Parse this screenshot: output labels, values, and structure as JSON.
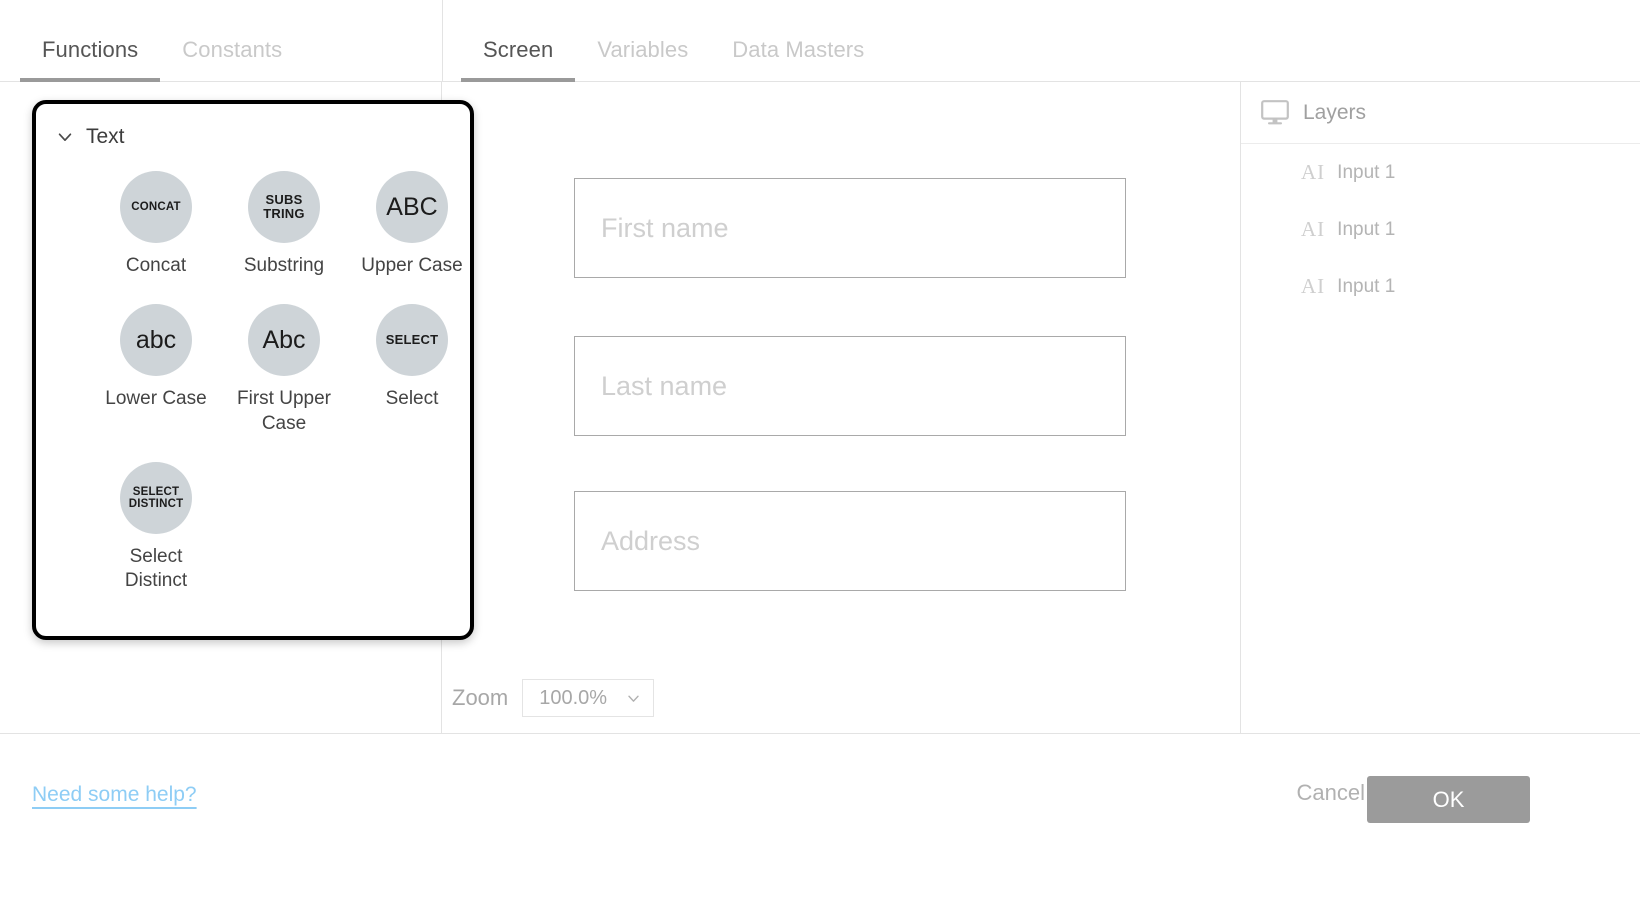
{
  "left_panel": {
    "tabs": [
      {
        "label": "Functions",
        "active": true
      },
      {
        "label": "Constants",
        "active": false
      }
    ],
    "popup": {
      "group_label": "Text",
      "collapse_icon": "chevron-down-icon",
      "functions": [
        {
          "glyph": "CONCAT",
          "label": "Concat",
          "size": "xs"
        },
        {
          "glyph": "SUBS\nTRING",
          "label": "Substring",
          "size": "sm"
        },
        {
          "glyph": "ABC",
          "label": "Upper Case",
          "size": "lg"
        },
        {
          "glyph": "abc",
          "label": "Lower Case",
          "size": "lg"
        },
        {
          "glyph": "Abc",
          "label": "First Upper Case",
          "size": "lg"
        },
        {
          "glyph": "SELECT",
          "label": "Select",
          "size": "sm"
        },
        {
          "glyph": "SELECT\nDISTINCT",
          "label": "Select Distinct",
          "size": "sm"
        }
      ]
    }
  },
  "center_panel": {
    "tabs": [
      {
        "label": "Screen",
        "active": true
      },
      {
        "label": "Variables",
        "active": false
      },
      {
        "label": "Data Masters",
        "active": false
      }
    ],
    "fields": [
      {
        "placeholder": "First name"
      },
      {
        "placeholder": "Last name"
      },
      {
        "placeholder": "Address"
      }
    ],
    "zoom": {
      "label": "Zoom",
      "value": "100.0%",
      "dropdown_icon": "chevron-down-icon"
    }
  },
  "right_panel": {
    "title": "Layers",
    "title_icon": "monitor-icon",
    "layers": [
      {
        "icon": "AI",
        "name": "Input 1"
      },
      {
        "icon": "AI",
        "name": "Input 1"
      },
      {
        "icon": "AI",
        "name": "Input 1"
      }
    ]
  },
  "footer": {
    "help_link": "Need some help?",
    "cancel_label": "Cancel",
    "ok_label": "OK"
  },
  "colors": {
    "accent_link": "#8ecdf5",
    "icon_circle": "#ced4d8",
    "tab_active": "#555555",
    "tab_inactive": "#c9c9c9",
    "ok_button": "#9b9b9b"
  }
}
